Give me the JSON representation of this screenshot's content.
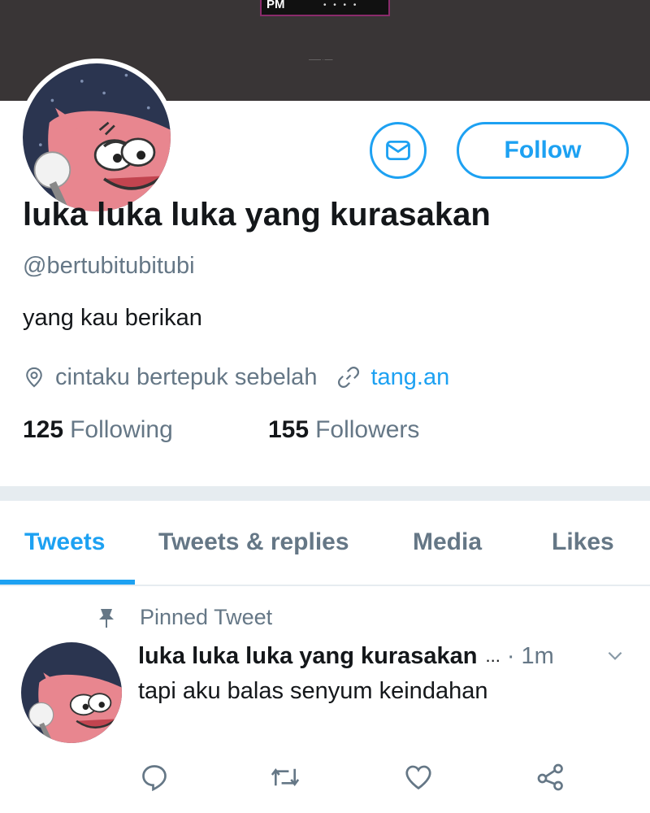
{
  "banner": {
    "logo_text": "PM",
    "dots": "• • • •",
    "tiny_text": "——— · ——"
  },
  "profile": {
    "display_name": "luka luka luka yang kurasakan",
    "handle": "@bertubitubitubi",
    "bio": "yang kau berikan",
    "location": "cintaku bertepuk sebelah",
    "website": "tang.an",
    "following_count": "125",
    "following_label": "Following",
    "followers_count": "155",
    "followers_label": "Followers",
    "follow_label": "Follow"
  },
  "tabs": [
    {
      "label": "Tweets",
      "active": true
    },
    {
      "label": "Tweets & replies",
      "active": false
    },
    {
      "label": "Media",
      "active": false
    },
    {
      "label": "Likes",
      "active": false
    }
  ],
  "tweet": {
    "pinned_label": "Pinned Tweet",
    "author": "luka luka luka yang kurasakan",
    "ellipsis": "...",
    "time": "· 1m",
    "text": "tapi aku balas senyum keindahan"
  },
  "icons": {
    "message": "envelope-icon",
    "location": "location-pin-icon",
    "link": "link-icon",
    "pin": "pin-icon",
    "chevron": "chevron-down-icon",
    "reply": "reply-icon",
    "retweet": "retweet-icon",
    "like": "heart-icon",
    "share": "share-icon"
  },
  "colors": {
    "accent": "#1da1f2",
    "secondary_text": "#657786",
    "banner": "#393536",
    "separator": "#e6ecf0"
  }
}
